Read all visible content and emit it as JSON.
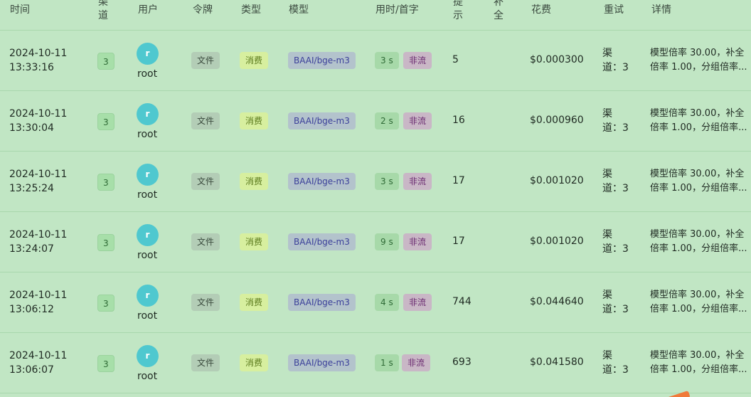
{
  "headers": {
    "time": "时间",
    "channel": "渠\n道",
    "user": "用户",
    "token": "令牌",
    "type": "类型",
    "model": "模型",
    "duration": "用时/首字",
    "prompt": "提\n示",
    "completion": "补\n全",
    "cost": "花费",
    "retry": "重试",
    "detail": "详情"
  },
  "rows": [
    {
      "date": "2024-10-11",
      "time": "13:33:16",
      "channel": "3",
      "avatar": "r",
      "user": "root",
      "token": "文件",
      "type": "消费",
      "model": "BAAI/bge-m3",
      "duration": "3 s",
      "stream": "非流",
      "prompt": "5",
      "completion": "",
      "cost": "$0.000300",
      "retry_line1": "渠",
      "retry_line2": "道：3",
      "detail_line1": "模型倍率 30.00，补全",
      "detail_line2": "倍率 1.00，分组倍率..."
    },
    {
      "date": "2024-10-11",
      "time": "13:30:04",
      "channel": "3",
      "avatar": "r",
      "user": "root",
      "token": "文件",
      "type": "消费",
      "model": "BAAI/bge-m3",
      "duration": "2 s",
      "stream": "非流",
      "prompt": "16",
      "completion": "",
      "cost": "$0.000960",
      "retry_line1": "渠",
      "retry_line2": "道：3",
      "detail_line1": "模型倍率 30.00，补全",
      "detail_line2": "倍率 1.00，分组倍率..."
    },
    {
      "date": "2024-10-11",
      "time": "13:25:24",
      "channel": "3",
      "avatar": "r",
      "user": "root",
      "token": "文件",
      "type": "消费",
      "model": "BAAI/bge-m3",
      "duration": "3 s",
      "stream": "非流",
      "prompt": "17",
      "completion": "",
      "cost": "$0.001020",
      "retry_line1": "渠",
      "retry_line2": "道：3",
      "detail_line1": "模型倍率 30.00，补全",
      "detail_line2": "倍率 1.00，分组倍率..."
    },
    {
      "date": "2024-10-11",
      "time": "13:24:07",
      "channel": "3",
      "avatar": "r",
      "user": "root",
      "token": "文件",
      "type": "消费",
      "model": "BAAI/bge-m3",
      "duration": "9 s",
      "stream": "非流",
      "prompt": "17",
      "completion": "",
      "cost": "$0.001020",
      "retry_line1": "渠",
      "retry_line2": "道：3",
      "detail_line1": "模型倍率 30.00，补全",
      "detail_line2": "倍率 1.00，分组倍率..."
    },
    {
      "date": "2024-10-11",
      "time": "13:06:12",
      "channel": "3",
      "avatar": "r",
      "user": "root",
      "token": "文件",
      "type": "消费",
      "model": "BAAI/bge-m3",
      "duration": "4 s",
      "stream": "非流",
      "prompt": "744",
      "completion": "",
      "cost": "$0.044640",
      "retry_line1": "渠",
      "retry_line2": "道：3",
      "detail_line1": "模型倍率 30.00，补全",
      "detail_line2": "倍率 1.00，分组倍率..."
    },
    {
      "date": "2024-10-11",
      "time": "13:06:07",
      "channel": "3",
      "avatar": "r",
      "user": "root",
      "token": "文件",
      "type": "消费",
      "model": "BAAI/bge-m3",
      "duration": "1 s",
      "stream": "非流",
      "prompt": "693",
      "completion": "",
      "cost": "$0.041580",
      "retry_line1": "渠",
      "retry_line2": "道：3",
      "detail_line1": "模型倍率 30.00，补全",
      "detail_line2": "倍率 1.00，分组倍率..."
    }
  ]
}
